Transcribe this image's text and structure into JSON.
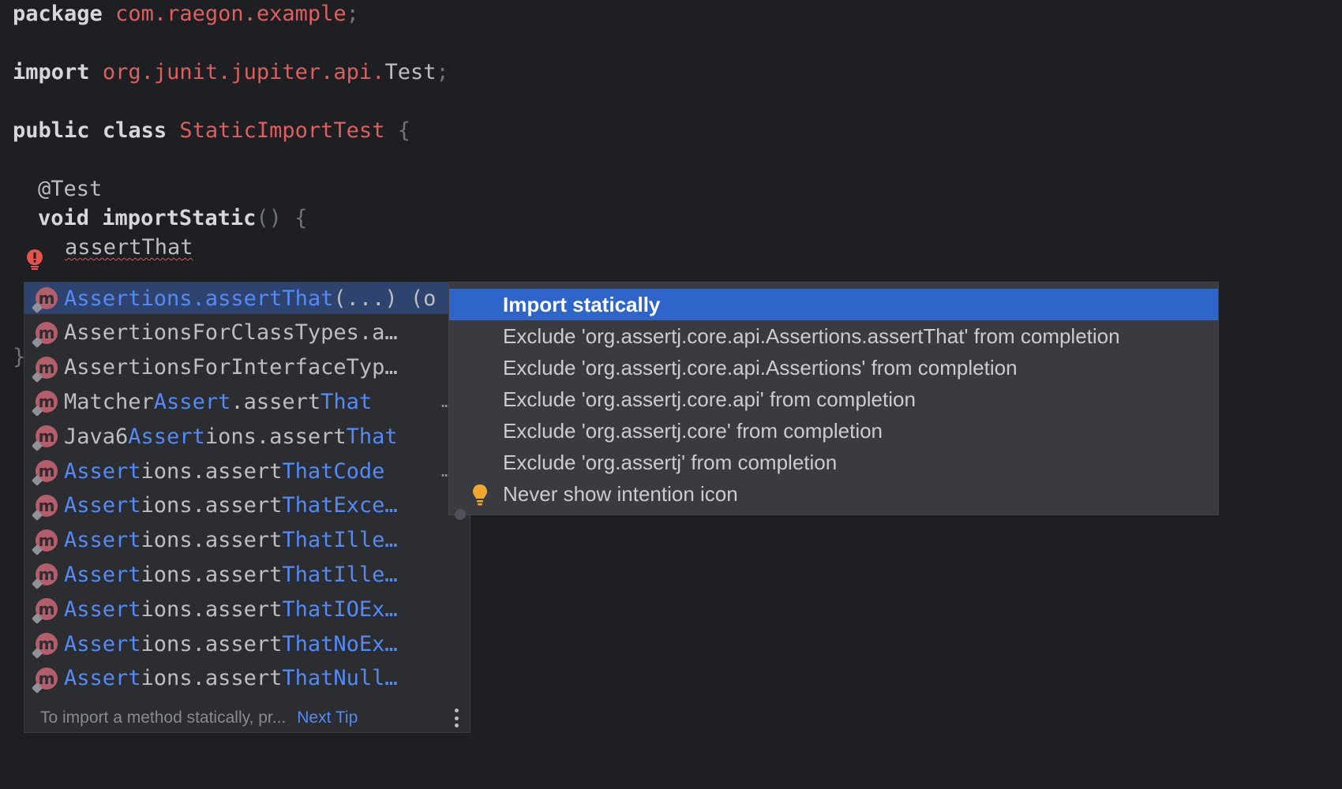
{
  "editor": {
    "package_kw": "package",
    "package_name": "com.raegon.example",
    "import_kw": "import",
    "import_pkg": "org.junit.jupiter.api.",
    "import_class": "Test",
    "public_kw": "public",
    "class_kw": "class",
    "class_name": "StaticImportTest",
    "annotation": "@Test",
    "void_kw": "void",
    "method_name": "importStatic",
    "method_parens": "()",
    "open_brace": "{",
    "semicolon": ";",
    "typed_text": "assertThat",
    "close_brace": "}"
  },
  "completion": {
    "items": [
      {
        "a": "Assertions.assert",
        "b": "That",
        "c": "(...) (o",
        "hl": [
          true,
          true,
          false
        ],
        "selected": true,
        "ellipsis": ""
      },
      {
        "a": "AssertionsForClassTypes.a…",
        "b": "",
        "c": "",
        "hl": [
          false,
          false,
          false
        ],
        "selected": false,
        "ellipsis": ""
      },
      {
        "a": "AssertionsForInterfaceTyp…",
        "b": "",
        "c": "",
        "hl": [
          false,
          false,
          false
        ],
        "selected": false,
        "ellipsis": ""
      },
      {
        "a": "Matcher",
        "b": "Assert",
        "c": ".assert",
        "d": "That",
        "hl": [
          false,
          true,
          false,
          true
        ],
        "selected": false,
        "ellipsis": "…"
      },
      {
        "a": "Java6",
        "b": "Assert",
        "c": "ions.assert",
        "d": "That",
        "hl": [
          false,
          true,
          false,
          true
        ],
        "selected": false,
        "ellipsis": ""
      },
      {
        "a": "Assert",
        "b": "ions.assert",
        "c": "That",
        "d": "Code",
        "hl": [
          true,
          false,
          true,
          true
        ],
        "selected": false,
        "ellipsis": "…"
      },
      {
        "a": "Assert",
        "b": "ions.assert",
        "c": "That",
        "d": "Exce…",
        "hl": [
          true,
          false,
          true,
          true
        ],
        "selected": false,
        "ellipsis": ""
      },
      {
        "a": "Assert",
        "b": "ions.assert",
        "c": "That",
        "d": "Ille…",
        "hl": [
          true,
          false,
          true,
          true
        ],
        "selected": false,
        "ellipsis": ""
      },
      {
        "a": "Assert",
        "b": "ions.assert",
        "c": "That",
        "d": "Ille…",
        "hl": [
          true,
          false,
          true,
          true
        ],
        "selected": false,
        "ellipsis": ""
      },
      {
        "a": "Assert",
        "b": "ions.assert",
        "c": "That",
        "d": "IOEx…",
        "hl": [
          true,
          false,
          true,
          true
        ],
        "selected": false,
        "ellipsis": ""
      },
      {
        "a": "Assert",
        "b": "ions.assert",
        "c": "That",
        "d": "NoEx…",
        "hl": [
          true,
          false,
          true,
          true
        ],
        "selected": false,
        "ellipsis": ""
      },
      {
        "a": "Assert",
        "b": "ions.assert",
        "c": "That",
        "d": "Null…",
        "hl": [
          true,
          false,
          true,
          true
        ],
        "selected": false,
        "ellipsis": ""
      }
    ],
    "icon_letter": "m",
    "footer_tip": "To import a method statically, pr...",
    "footer_link": "Next Tip"
  },
  "intention_menu": {
    "items": [
      "Import statically",
      "Exclude 'org.assertj.core.api.Assertions.assertThat' from completion",
      "Exclude 'org.assertj.core.api.Assertions' from completion",
      "Exclude 'org.assertj.core.api' from completion",
      "Exclude 'org.assertj.core' from completion",
      "Exclude 'org.assertj' from completion",
      "Never show intention icon"
    ],
    "selected_index": 0
  },
  "colors": {
    "background": "#1e1f22",
    "popup": "#2b2d30",
    "menu": "#393b40",
    "selection": "#2f65ca",
    "match_highlight": "#548af7",
    "string_red": "#dd5f5f"
  }
}
